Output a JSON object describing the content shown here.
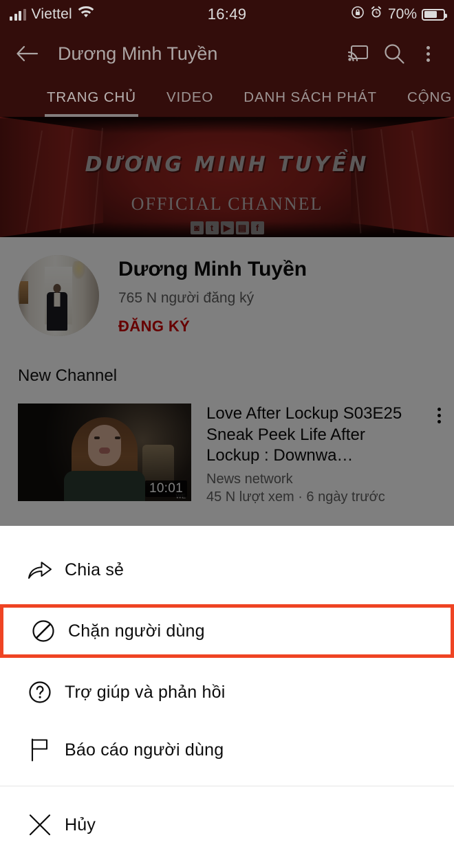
{
  "status_bar": {
    "carrier": "Viettel",
    "time": "16:49",
    "battery_percent": "70%",
    "icons": [
      "signal-bars-icon",
      "wifi-icon",
      "rotation-lock-icon",
      "alarm-clock-icon",
      "battery-icon"
    ]
  },
  "app_bar": {
    "title": "Dương Minh Tuyền",
    "back_icon": "back-arrow-icon",
    "cast_icon": "cast-icon",
    "search_icon": "search-icon",
    "overflow_icon": "more-vertical-icon"
  },
  "tabs": [
    {
      "label": "TRANG CHỦ",
      "active": true
    },
    {
      "label": "VIDEO",
      "active": false
    },
    {
      "label": "DANH SÁCH PHÁT",
      "active": false
    },
    {
      "label": "CỘNG ĐỒ",
      "active": false
    }
  ],
  "banner": {
    "title": "DƯƠNG MINH TUYỀN",
    "subtitle": "OFFICIAL CHANNEL",
    "socials": [
      "instagram-icon",
      "twitter-icon",
      "youtube-icon",
      "twitch-icon",
      "facebook-icon"
    ]
  },
  "channel": {
    "avatar_name": "channel-avatar",
    "name": "Dương Minh Tuyền",
    "subscribers": "765 N người đăng ký",
    "subscribe_label": "ĐĂNG KÝ",
    "subscribe_color": "#cc0000"
  },
  "section": {
    "title": "New Channel"
  },
  "video": {
    "title": "Love After Lockup S03E25 Sneak Peek Life After Lockup : Downwa…",
    "channel": "News network",
    "stats": "45 N lượt xem · 6 ngày trước",
    "duration": "10:01",
    "overflow_icon": "more-vertical-icon"
  },
  "sheet": {
    "highlight_color": "#ef4423",
    "items": [
      {
        "label": "Chia sẻ",
        "icon": "share-icon",
        "highlighted": false
      },
      {
        "label": "Chặn người dùng",
        "icon": "block-icon",
        "highlighted": true
      },
      {
        "label": "Trợ giúp và phản hồi",
        "icon": "help-circle-icon",
        "highlighted": false
      },
      {
        "label": "Báo cáo người dùng",
        "icon": "flag-icon",
        "highlighted": false
      },
      {
        "label": "Hủy",
        "icon": "close-icon",
        "highlighted": false
      }
    ]
  }
}
